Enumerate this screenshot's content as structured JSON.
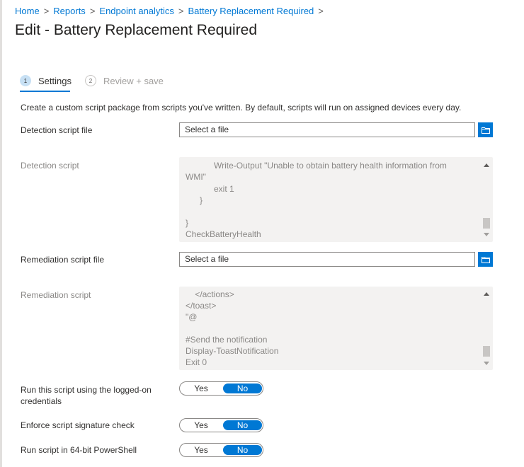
{
  "breadcrumb": [
    "Home",
    "Reports",
    "Endpoint analytics",
    "Battery Replacement Required"
  ],
  "title": "Edit - Battery Replacement Required",
  "steps": [
    {
      "num": "1",
      "label": "Settings",
      "active": true
    },
    {
      "num": "2",
      "label": "Review + save",
      "active": false
    }
  ],
  "description": "Create a custom script package from scripts you've written. By default, scripts will run on assigned devices every day.",
  "detection_file": {
    "label": "Detection script file",
    "placeholder": "Select a file"
  },
  "detection_script": {
    "label": "Detection script",
    "lines": [
      "            Write-Output \"Unable to obtain battery health information from",
      "WMI\"",
      "            exit 1",
      "      }",
      "",
      "}",
      "CheckBatteryHealth"
    ]
  },
  "remediation_file": {
    "label": "Remediation script file",
    "placeholder": "Select a file"
  },
  "remediation_script": {
    "label": "Remediation script",
    "lines": [
      "    </actions>",
      "</toast>",
      "\"@",
      "",
      "#Send the notification",
      "Display-ToastNotification",
      "Exit 0"
    ]
  },
  "toggles": [
    {
      "label": "Run this script using the logged-on credentials",
      "yes": "Yes",
      "no": "No",
      "value": "No"
    },
    {
      "label": "Enforce script signature check",
      "yes": "Yes",
      "no": "No",
      "value": "No"
    },
    {
      "label": "Run script in 64-bit PowerShell",
      "yes": "Yes",
      "no": "No",
      "value": "No"
    }
  ],
  "colors": {
    "accent": "#0078d4"
  }
}
